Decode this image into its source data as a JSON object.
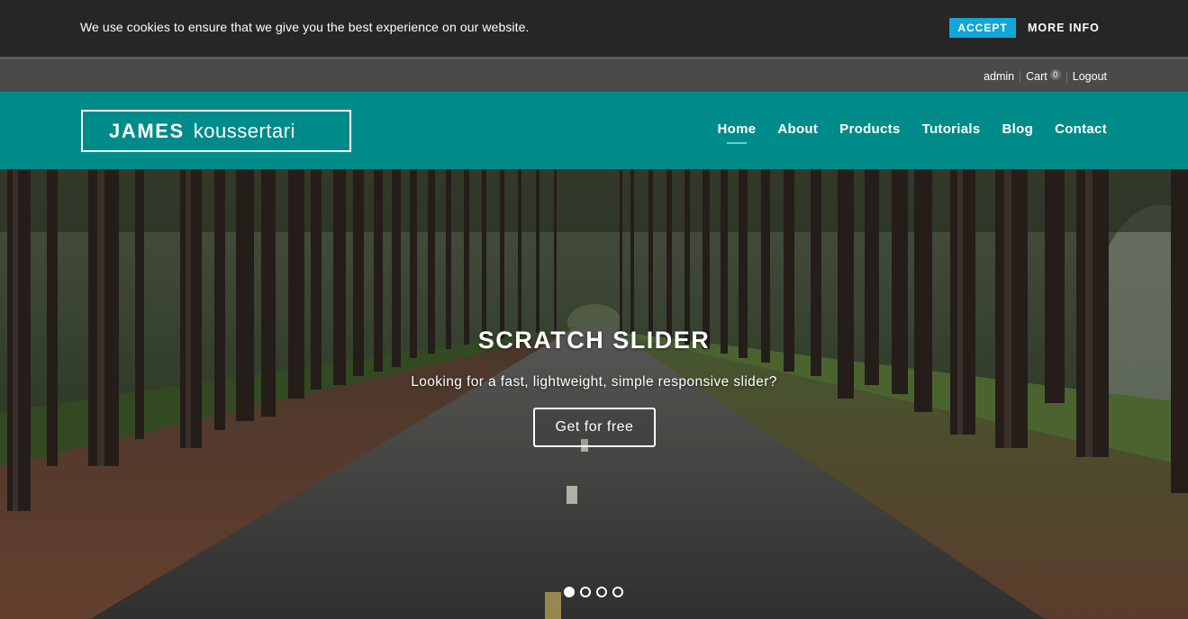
{
  "cookie_banner": {
    "message": "We use cookies to ensure that we give you the best experience on our website.",
    "accept_label": "ACCEPT",
    "more_info_label": "MORE INFO",
    "accept_color": "#11a7d6"
  },
  "utility": {
    "user": "admin",
    "cart_label": "Cart",
    "cart_count": "0",
    "logout_label": "Logout"
  },
  "header": {
    "logo_bold": "JAMES",
    "logo_light": "koussertari",
    "brand_color": "#008b8b",
    "nav": [
      {
        "label": "Home",
        "active": true
      },
      {
        "label": "About"
      },
      {
        "label": "Products"
      },
      {
        "label": "Tutorials"
      },
      {
        "label": "Blog"
      },
      {
        "label": "Contact"
      }
    ]
  },
  "hero": {
    "title": "SCRATCH SLIDER",
    "subtitle": "Looking for a fast, lightweight, simple responsive slider?",
    "cta_label": "Get for free",
    "slide_count": 4,
    "active_slide": 1
  }
}
